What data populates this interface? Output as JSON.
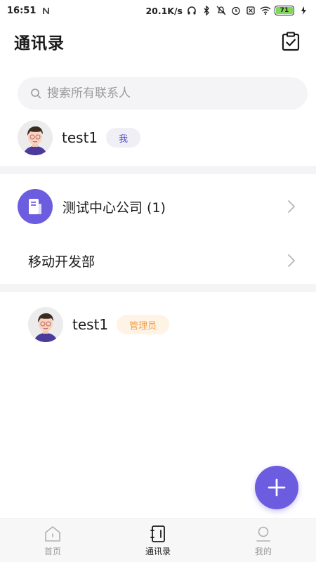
{
  "status_bar": {
    "time": "16:51",
    "network_speed": "20.1K/s",
    "battery": "71",
    "icons": [
      "n-icon",
      "headphones-icon",
      "bluetooth-icon",
      "mute-icon",
      "alarm-icon",
      "sim-icon",
      "wifi-icon",
      "battery-icon",
      "charging-icon"
    ]
  },
  "header": {
    "title": "通讯录",
    "action_icon": "clipboard-check-icon"
  },
  "search": {
    "placeholder": "搜索所有联系人",
    "value": ""
  },
  "me": {
    "name": "test1",
    "badge": "我"
  },
  "company": {
    "name": "测试中心公司 (1)"
  },
  "department": {
    "name": "移动开发部"
  },
  "member": {
    "name": "test1",
    "badge": "管理员"
  },
  "fab": {
    "icon": "plus-icon"
  },
  "bottom_nav": {
    "items": [
      {
        "label": "首页",
        "icon": "home-icon",
        "active": false
      },
      {
        "label": "通讯录",
        "icon": "contacts-icon",
        "active": true
      },
      {
        "label": "我的",
        "icon": "profile-icon",
        "active": false
      }
    ]
  },
  "colors": {
    "accent": "#6c5ce0",
    "me_badge_text": "#5b53c8",
    "admin_badge_text": "#f0a04b",
    "divider": "#f4f4f6"
  }
}
